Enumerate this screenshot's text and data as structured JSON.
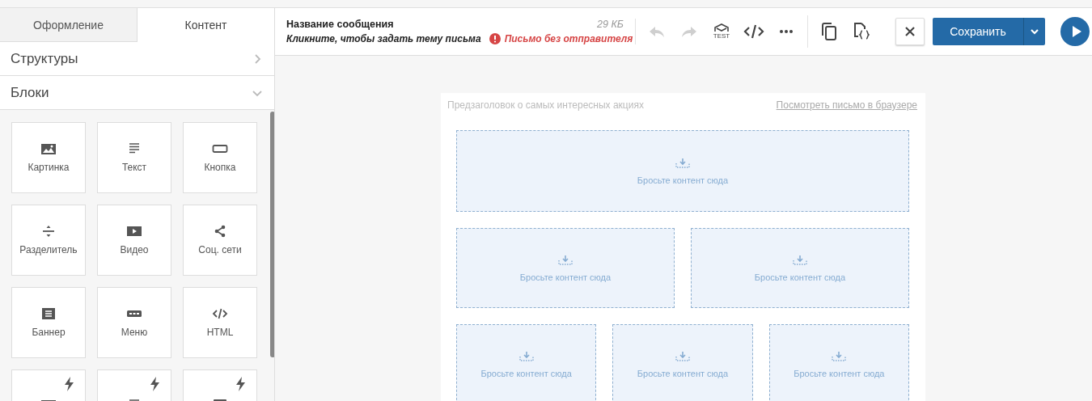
{
  "tabs": [
    {
      "label": "Оформление",
      "selected": false
    },
    {
      "label": "Контент",
      "selected": true
    }
  ],
  "sections": [
    {
      "title": "Структуры",
      "expanded": false
    },
    {
      "title": "Блоки",
      "expanded": true
    }
  ],
  "blocks": [
    {
      "label": "Картинка",
      "dynamic": false
    },
    {
      "label": "Текст",
      "dynamic": false
    },
    {
      "label": "Кнопка",
      "dynamic": false
    },
    {
      "label": "Разделитель",
      "dynamic": false
    },
    {
      "label": "Видео",
      "dynamic": false
    },
    {
      "label": "Соц. сети",
      "dynamic": false
    },
    {
      "label": "Баннер",
      "dynamic": false
    },
    {
      "label": "Меню",
      "dynamic": false
    },
    {
      "label": "HTML",
      "dynamic": false
    },
    {
      "dynamic": true
    },
    {
      "dynamic": true
    },
    {
      "dynamic": true
    }
  ],
  "header": {
    "title": "Название сообщения",
    "subject": "Кликните, чтобы задать тему письма",
    "warning": "Письмо без отправителя",
    "size": "29 КБ"
  },
  "toolbar": [
    {
      "kind": "undo",
      "disabled": true
    },
    {
      "kind": "redo",
      "disabled": true
    },
    {
      "kind": "test",
      "label": "TEST",
      "disabled": false
    },
    {
      "kind": "code",
      "disabled": false
    },
    {
      "kind": "more",
      "disabled": false
    },
    {
      "kind": "separator"
    },
    {
      "kind": "copy",
      "disabled": false
    },
    {
      "kind": "json",
      "disabled": false
    }
  ],
  "save_button": {
    "label": "Сохранить"
  },
  "email": {
    "preheader": "Предзаголовок о самых интересных акциях",
    "browser_link": "Посмотреть письмо в браузере",
    "rows": [
      {
        "zones": [
          "Бросьте контент сюда"
        ]
      },
      {
        "zones": [
          "Бросьте контент сюда",
          "Бросьте контент сюда"
        ]
      },
      {
        "zones": [
          "Бросьте контент сюда",
          "Бросьте контент сюда",
          "Бросьте контент сюда"
        ]
      }
    ]
  }
}
